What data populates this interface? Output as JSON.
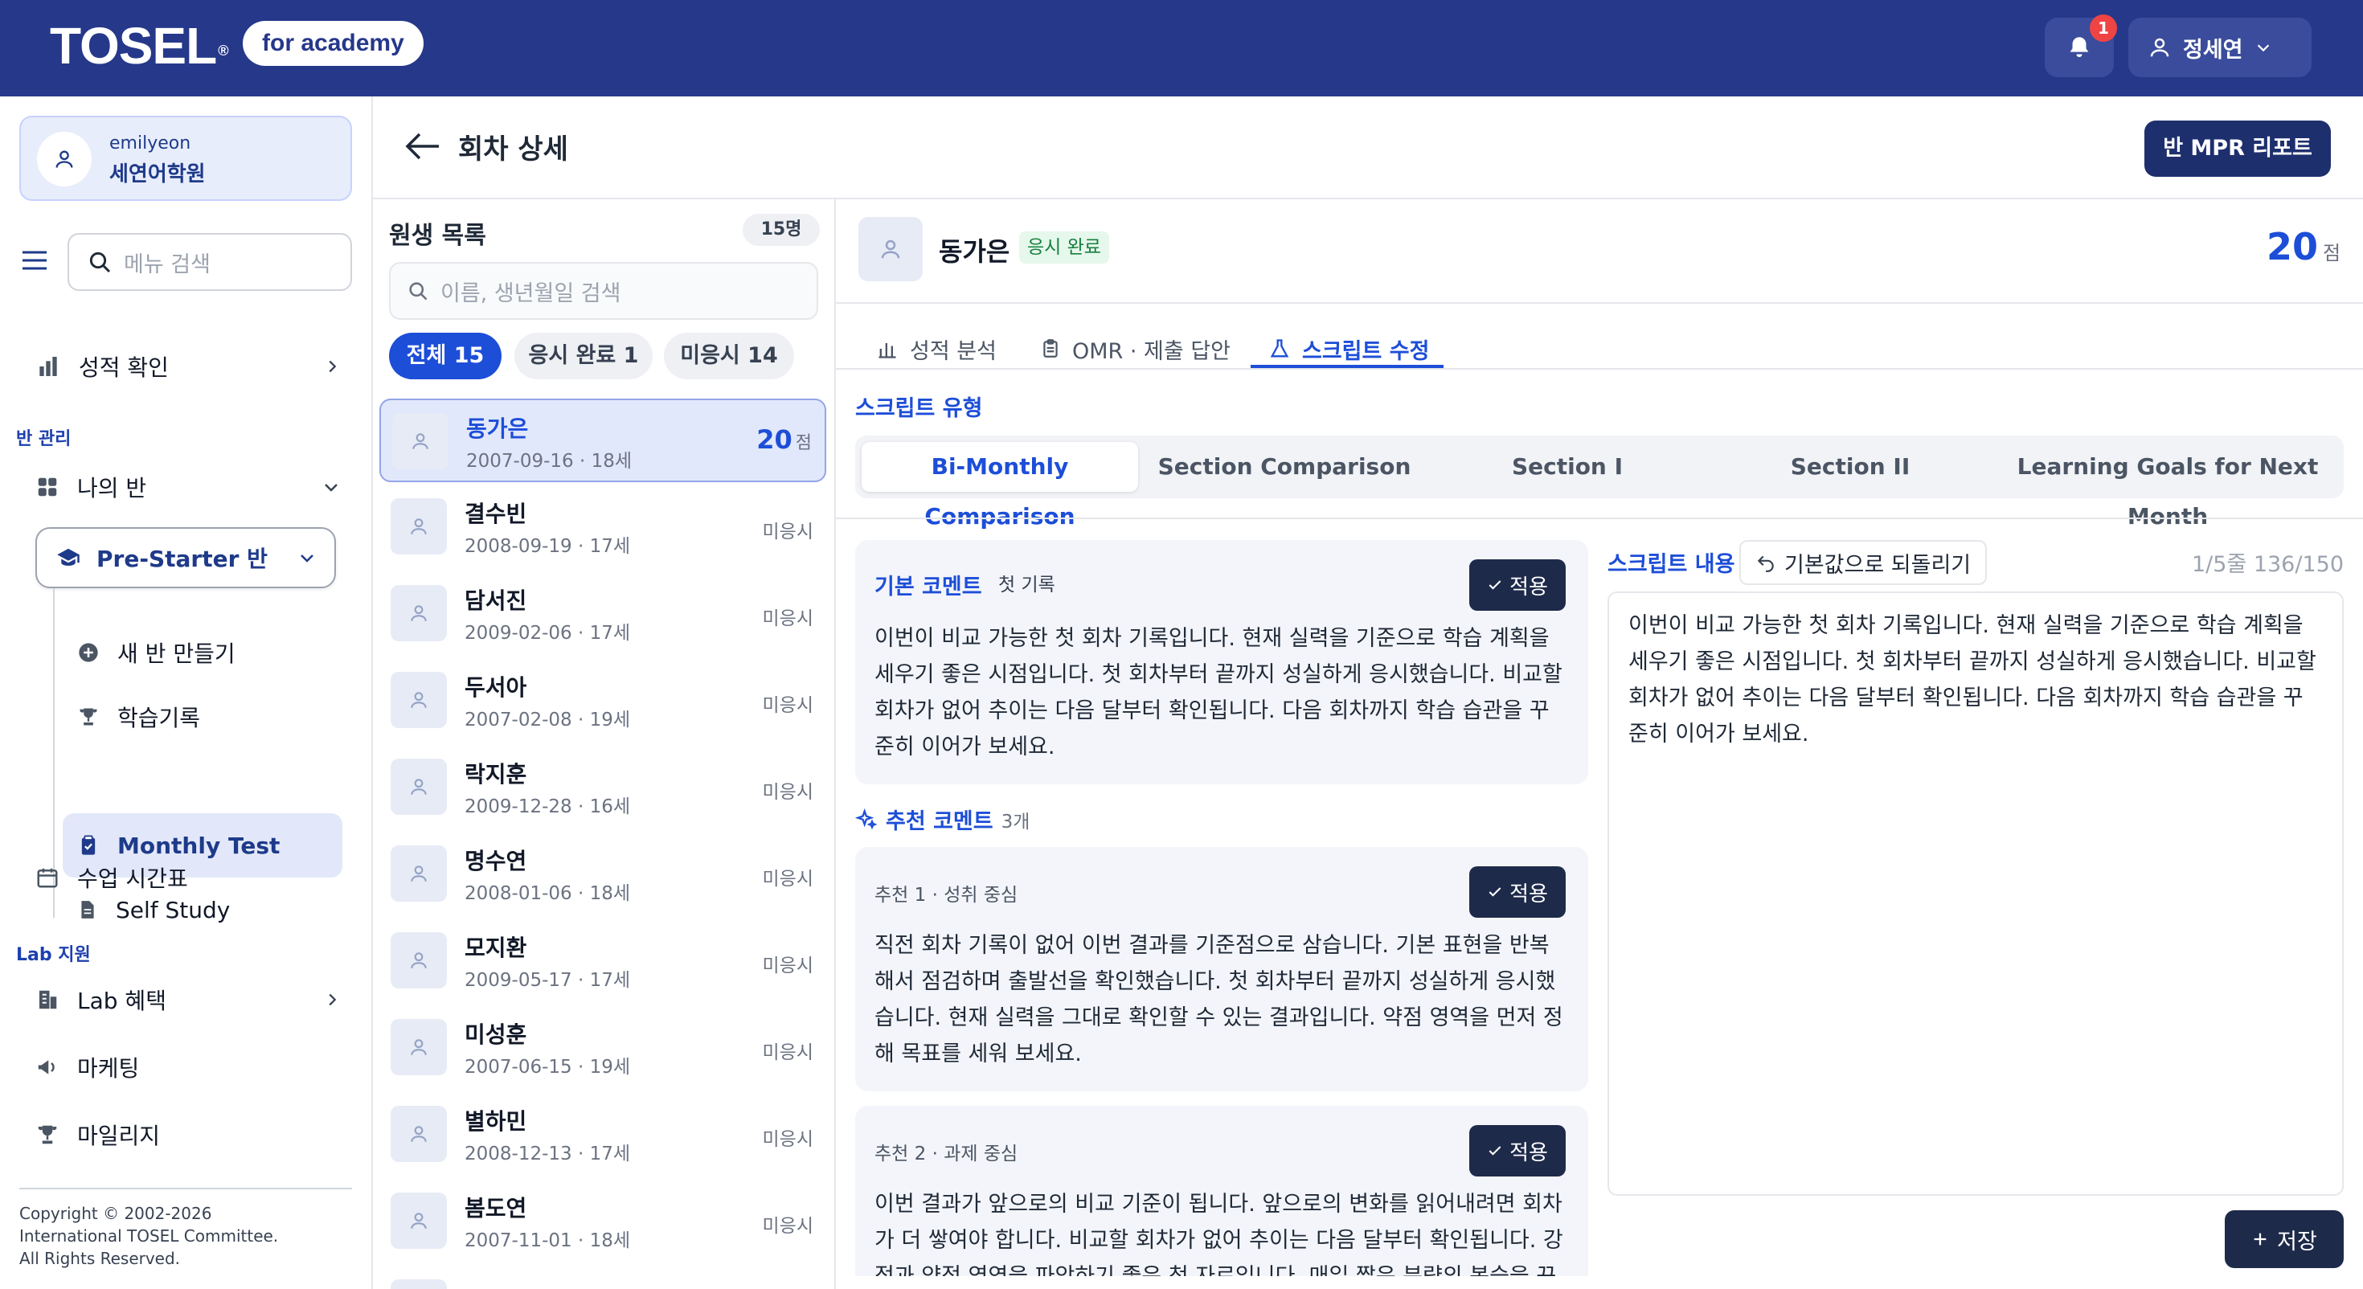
{
  "header": {
    "logo": "TOSEL",
    "logo_mark": "®",
    "product": "for academy",
    "notif_count": "1",
    "user_name": "정세연"
  },
  "account": {
    "id": "emilyeon",
    "academy": "세연어학원"
  },
  "menu_search": {
    "placeholder": "메뉴 검색"
  },
  "nav": {
    "grades": "성적 확인",
    "class_section": "반 관리",
    "my_class": "나의 반",
    "class_select": "Pre-Starter 반",
    "sub_items": [
      "새 반 만들기",
      "학습기록",
      "Monthly Test",
      "Self Study"
    ],
    "timetable": "수업 시간표",
    "lab_section": "Lab 지원",
    "lab_items": [
      "Lab 혜택",
      "마케팅",
      "마일리지"
    ]
  },
  "copyright": [
    "Copyright © 2002-2026",
    "International TOSEL Committee.",
    "All Rights Reserved."
  ],
  "page": {
    "title": "회차 상세",
    "mpr_button": "반 MPR 리포트"
  },
  "students": {
    "title": "원생 목록",
    "count": "15명",
    "search_placeholder": "이름, 생년월일 검색",
    "filters": [
      "전체 15",
      "응시 완료 1",
      "미응시 14"
    ],
    "rows": [
      {
        "name": "동가은",
        "dob": "2007-09-16 · 18세",
        "score": "20",
        "unit": "점"
      },
      {
        "name": "결수빈",
        "dob": "2008-09-19 · 17세",
        "status": "미응시"
      },
      {
        "name": "담서진",
        "dob": "2009-02-06 · 17세",
        "status": "미응시"
      },
      {
        "name": "두서아",
        "dob": "2007-02-08 · 19세",
        "status": "미응시"
      },
      {
        "name": "락지훈",
        "dob": "2009-12-28 · 16세",
        "status": "미응시"
      },
      {
        "name": "명수연",
        "dob": "2008-01-06 · 18세",
        "status": "미응시"
      },
      {
        "name": "모지환",
        "dob": "2009-05-17 · 17세",
        "status": "미응시"
      },
      {
        "name": "미성훈",
        "dob": "2007-06-15 · 19세",
        "status": "미응시"
      },
      {
        "name": "별하민",
        "dob": "2008-12-13 · 17세",
        "status": "미응시"
      },
      {
        "name": "봄도연",
        "dob": "2007-11-01 · 18세",
        "status": "미응시"
      }
    ]
  },
  "detail": {
    "name": "동가은",
    "status": "응시 완료",
    "score": "20",
    "unit": "점",
    "tabs": [
      "성적 분석",
      "OMR · 제출 답안",
      "스크립트 수정"
    ],
    "script_type_label": "스크립트 유형",
    "script_types": [
      "Bi-Monthly Comparison",
      "Section Comparison",
      "Section I",
      "Section II",
      "Learning Goals for Next Month"
    ],
    "base": {
      "title": "기본 코멘트",
      "tag": "첫 기록",
      "apply": "적용",
      "text": "이번이 비교 가능한 첫 회차 기록입니다. 현재 실력을 기준으로 학습 계획을 세우기 좋은 시점입니다. 첫 회차부터 끝까지 성실하게 응시했습니다. 비교할 회차가 없어 추이는 다음 달부터 확인됩니다. 다음 회차까지 학습 습관을 꾸준히 이어가 보세요."
    },
    "rec_label": "추천 코멘트",
    "rec_count": "3개",
    "recs": [
      {
        "title": "추천 1 · 성취 중심",
        "apply": "적용",
        "text": "직전 회차 기록이 없어 이번 결과를 기준점으로 삼습니다. 기본 표현을 반복해서 점검하며 출발선을 확인했습니다. 첫 회차부터 끝까지 성실하게 응시했습니다. 현재 실력을 그대로 확인할 수 있는 결과입니다. 약점 영역을 먼저 정해 목표를 세워 보세요."
      },
      {
        "title": "추천 2 · 과제 중심",
        "apply": "적용",
        "text": "이번 결과가 앞으로의 비교 기준이 됩니다. 앞으로의 변화를 읽어내려면 회차가 더 쌓여야 합니다. 비교할 회차가 없어 추이는 다음 달부터 확인됩니다. 강점과 약점 영역을 파악하기 좋은 첫 자료입니다. 매일 짧은 분량의 복습을 꾸준히 이어가 보세요."
      }
    ],
    "script_label": "스크립트 내용",
    "reset": "기본값으로 되돌리기",
    "script_count": "1/5줄  136/150",
    "script_text": "이번이 비교 가능한 첫 회차 기록입니다. 현재 실력을 기준으로 학습 계획을 세우기 좋은 시점입니다. 첫 회차부터 끝까지 성실하게 응시했습니다. 비교할 회차가 없어 추이는 다음 달부터 확인됩니다. 다음 회차까지 학습 습관을 꾸준히 이어가 보세요.",
    "save": "저장"
  },
  "colors": {
    "header": "#26388a",
    "accent": "#1d4ed8",
    "dark_button": "#1e2a4a",
    "done_green": "#15803d",
    "badge_red": "#ef4444"
  }
}
